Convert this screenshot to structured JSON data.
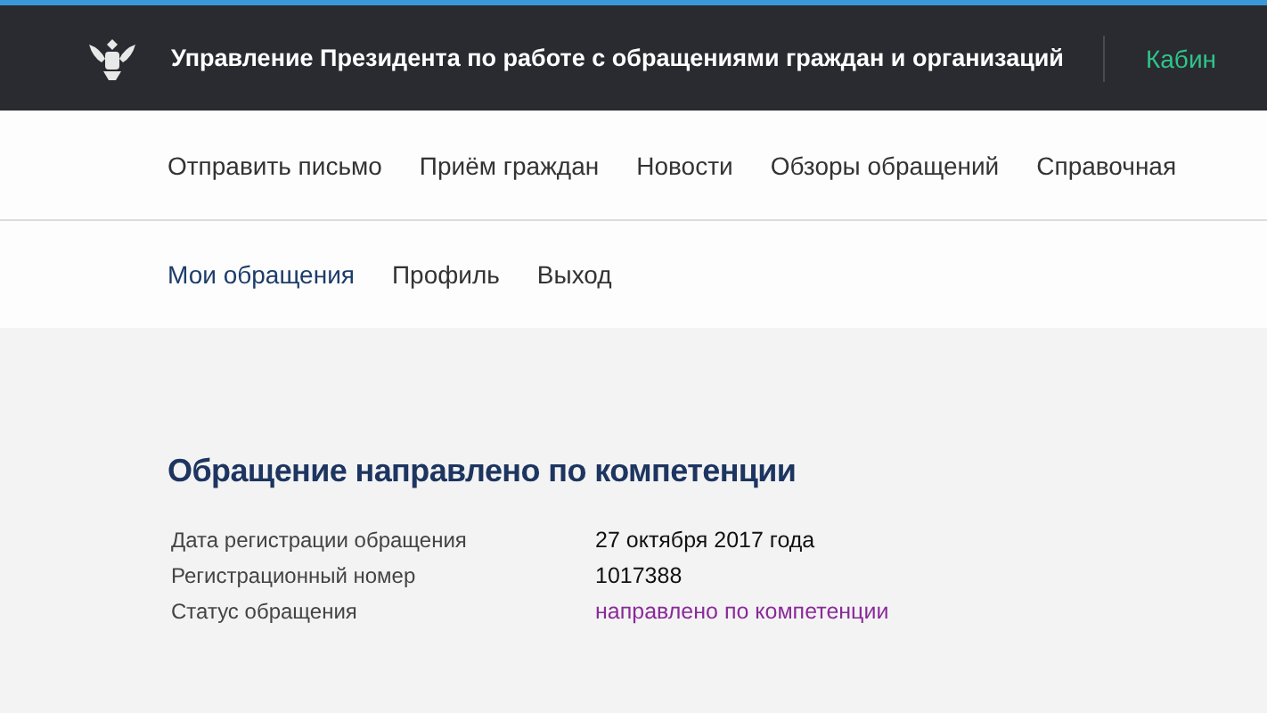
{
  "header": {
    "title": "Управление Президента по работе с обращениями граждан и организаций",
    "cabinet_link": "Кабин"
  },
  "main_nav": [
    {
      "label": "Отправить письмо"
    },
    {
      "label": "Приём граждан"
    },
    {
      "label": "Новости"
    },
    {
      "label": "Обзоры обращений"
    },
    {
      "label": "Справочная"
    }
  ],
  "sub_nav": [
    {
      "label": "Мои обращения",
      "selected": true
    },
    {
      "label": "Профиль",
      "selected": false
    },
    {
      "label": "Выход",
      "selected": false
    }
  ],
  "appeal": {
    "title": "Обращение направлено по компетенции",
    "rows": [
      {
        "label": "Дата регистрации обращения",
        "value": "27 октября 2017 года",
        "kind": "text"
      },
      {
        "label": "Регистрационный номер",
        "value": "1017388",
        "kind": "text"
      },
      {
        "label": "Статус обращения",
        "value": "направлено по компетенции",
        "kind": "status"
      }
    ]
  }
}
